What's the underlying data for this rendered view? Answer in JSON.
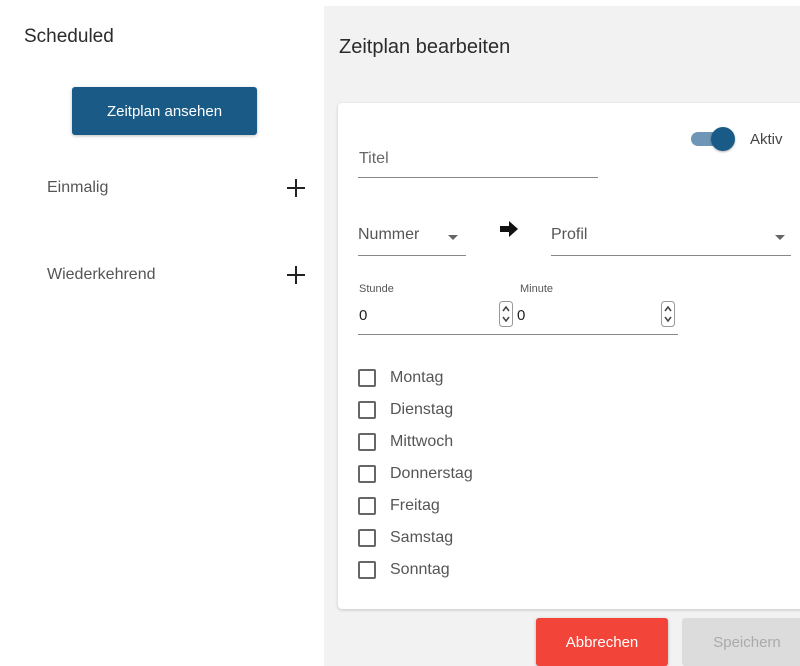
{
  "sidebar": {
    "title": "Scheduled",
    "view_button": "Zeitplan ansehen",
    "items": [
      {
        "label": "Einmalig"
      },
      {
        "label": "Wiederkehrend"
      }
    ]
  },
  "editor": {
    "title": "Zeitplan bearbeiten",
    "title_field": {
      "label": "Titel",
      "value": ""
    },
    "active_toggle": {
      "label": "Aktiv",
      "checked": true
    },
    "number_select": {
      "label": "Nummer"
    },
    "profile_select": {
      "label": "Profil"
    },
    "hour": {
      "label": "Stunde",
      "value": "0"
    },
    "minute": {
      "label": "Minute",
      "value": "0"
    },
    "days": [
      {
        "label": "Montag",
        "checked": false
      },
      {
        "label": "Dienstag",
        "checked": false
      },
      {
        "label": "Mittwoch",
        "checked": false
      },
      {
        "label": "Donnerstag",
        "checked": false
      },
      {
        "label": "Freitag",
        "checked": false
      },
      {
        "label": "Samstag",
        "checked": false
      },
      {
        "label": "Sonntag",
        "checked": false
      }
    ],
    "cancel_button": "Abbrechen",
    "save_button": "Speichern"
  },
  "colors": {
    "primary": "#1a5a87",
    "danger": "#f24438",
    "disabled": "#dcdcdc"
  }
}
